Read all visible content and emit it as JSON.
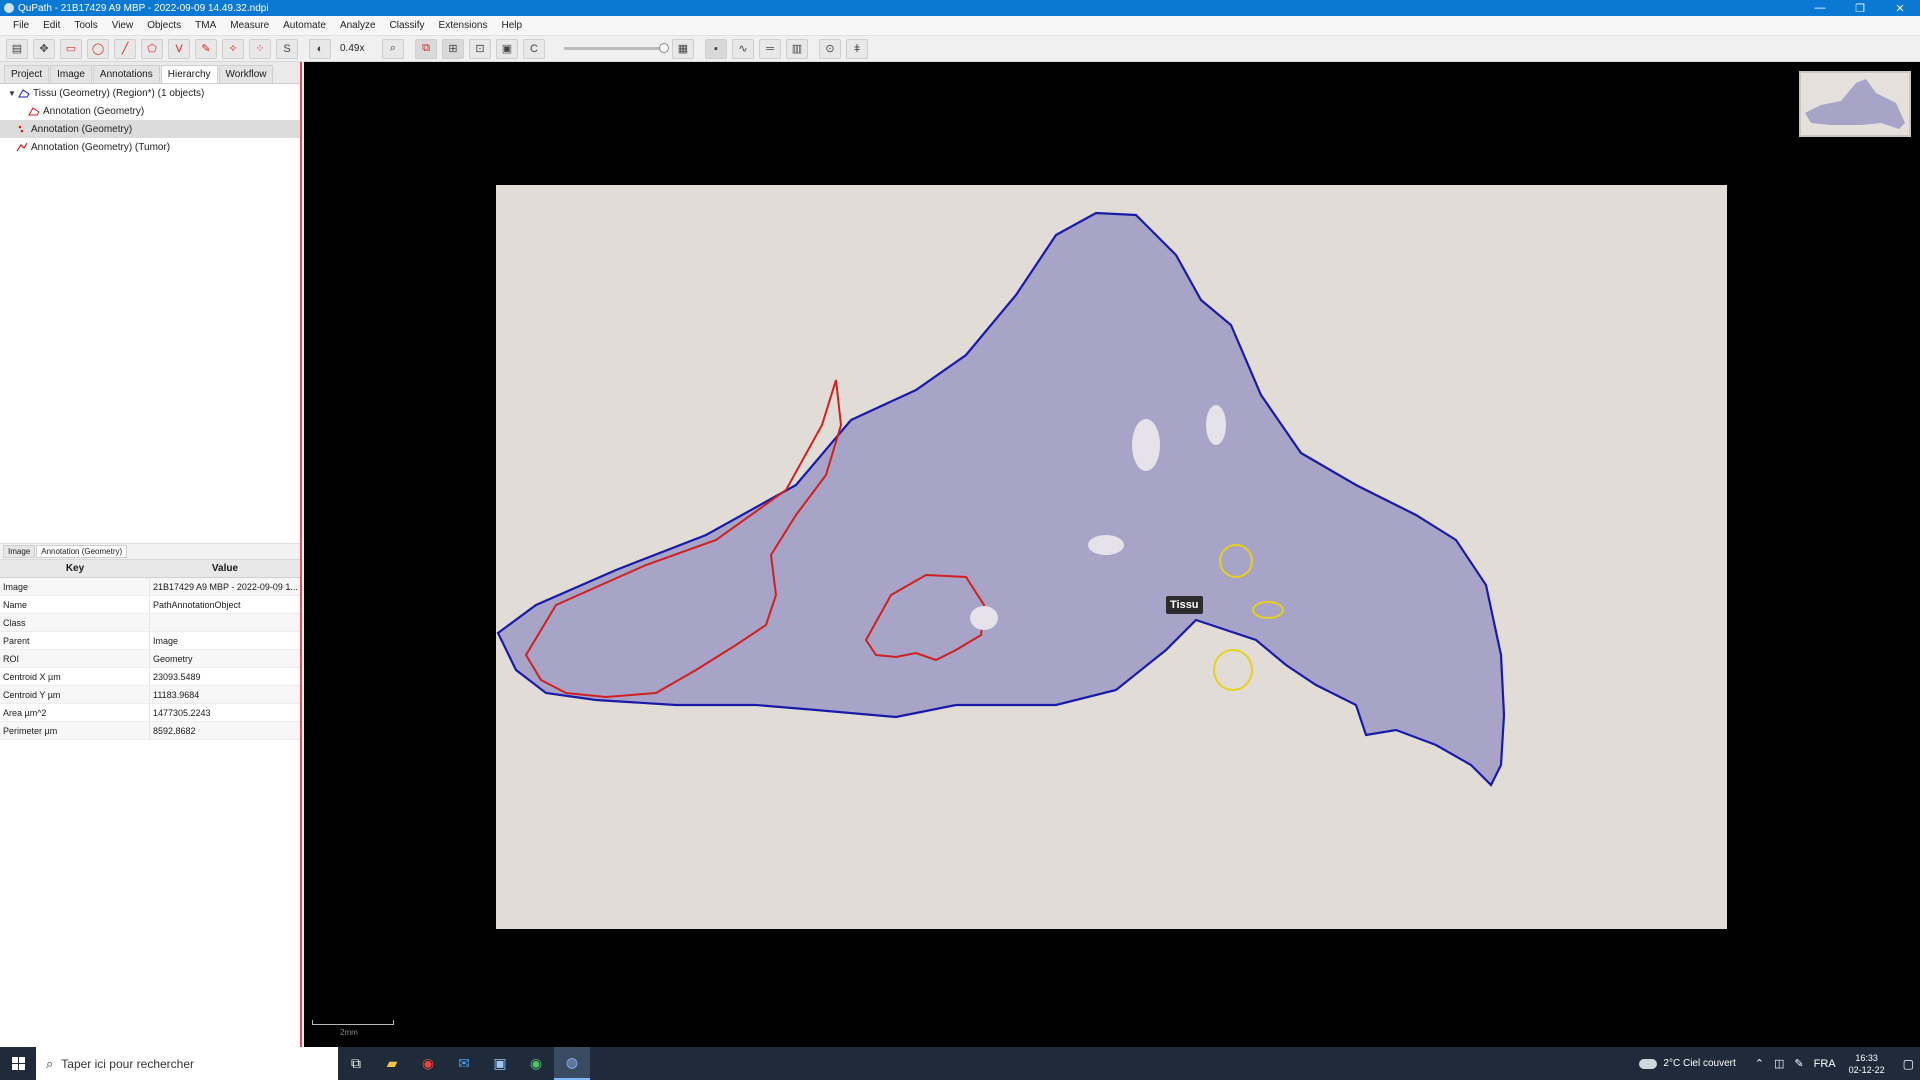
{
  "window": {
    "title": "QuPath - 21B17429 A9 MBP - 2022-09-09 14.49.32.ndpi",
    "minimize": "—",
    "maximize": "❐",
    "close": "✕"
  },
  "menu": [
    "File",
    "Edit",
    "Tools",
    "View",
    "Objects",
    "TMA",
    "Measure",
    "Automate",
    "Analyze",
    "Classify",
    "Extensions",
    "Help"
  ],
  "toolbar": {
    "zoom": "0.49x"
  },
  "left_panel": {
    "tabs": [
      "Project",
      "Image",
      "Annotations",
      "Hierarchy",
      "Workflow"
    ],
    "active_tab": "Hierarchy",
    "tree": [
      "Tissu (Geometry) (Region*) (1 objects)",
      "Annotation (Geometry)",
      "Annotation (Geometry)",
      "Annotation (Geometry) (Tumor)"
    ],
    "subtabs": [
      "Image",
      "Annotation (Geometry)"
    ],
    "table_headers": [
      "Key",
      "Value"
    ],
    "rows": [
      {
        "k": "Image",
        "v": "21B17429 A9 MBP - 2022-09-09 1..."
      },
      {
        "k": "Name",
        "v": "PathAnnotationObject"
      },
      {
        "k": "Class",
        "v": ""
      },
      {
        "k": "Parent",
        "v": "Image"
      },
      {
        "k": "ROI",
        "v": "Geometry"
      },
      {
        "k": "Centroid X µm",
        "v": "23093.5489"
      },
      {
        "k": "Centroid Y µm",
        "v": "11183.9684"
      },
      {
        "k": "Area µm^2",
        "v": "1477305.2243"
      },
      {
        "k": "Perimeter µm",
        "v": "8592.8682"
      }
    ]
  },
  "viewer": {
    "annotation_label": "Tissu",
    "scale_label": "2mm",
    "colors": {
      "tissue_outline": "#1a1aa8",
      "tumor_outline": "#d02020",
      "other_outline": "#e6d020",
      "tissue_fill": "#a7a4c8",
      "slide_bg": "#e2dcd6"
    }
  },
  "taskbar": {
    "search_placeholder": "Taper ici pour rechercher",
    "weather": "2°C  Ciel couvert",
    "language": "FRA",
    "time": "16:33",
    "date": "02-12-22"
  }
}
